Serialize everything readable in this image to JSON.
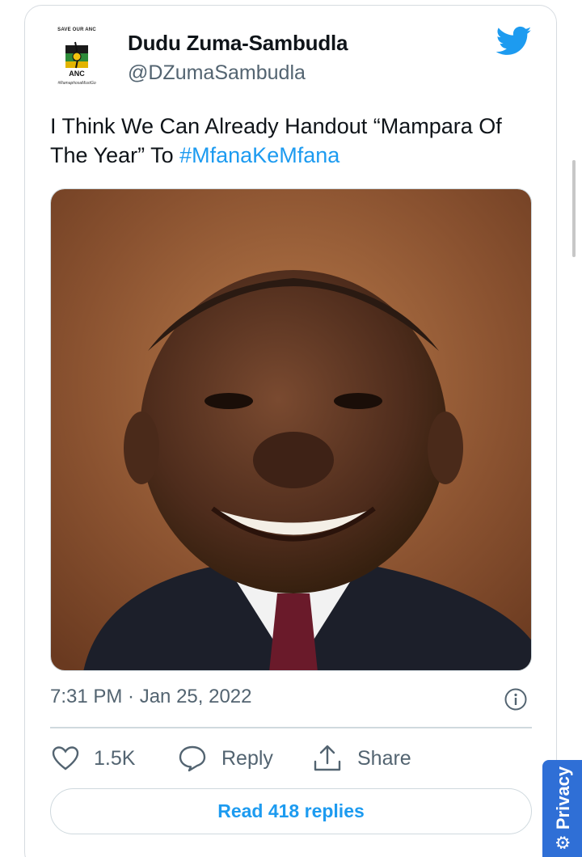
{
  "tweet": {
    "avatar": {
      "caption_top": "SAVE OUR ANC",
      "logo_text": "ANC",
      "caption_bottom": "#RamaphosaMustGo"
    },
    "display_name": "Dudu Zuma-Sambudla",
    "handle": "@DZumaSambudla",
    "text_main": "I Think We Can Already Handout “Mampara Of The Year” To ",
    "hashtag": "#MfanaKeMfana",
    "timestamp": "7:31 PM · Jan 25, 2022",
    "actions": {
      "like_count": "1.5K",
      "reply_label": "Reply",
      "share_label": "Share"
    },
    "read_replies_label": "Read 418 replies"
  },
  "privacy_tab": {
    "label": "Privacy"
  },
  "icons": [
    "twitter-bird-icon",
    "info-icon",
    "heart-icon",
    "reply-bubble-icon",
    "share-icon",
    "gear-icon"
  ],
  "colors": {
    "accent": "#1d9bf0",
    "secondary_text": "#536471",
    "privacy_tab": "#2f6fd6"
  }
}
